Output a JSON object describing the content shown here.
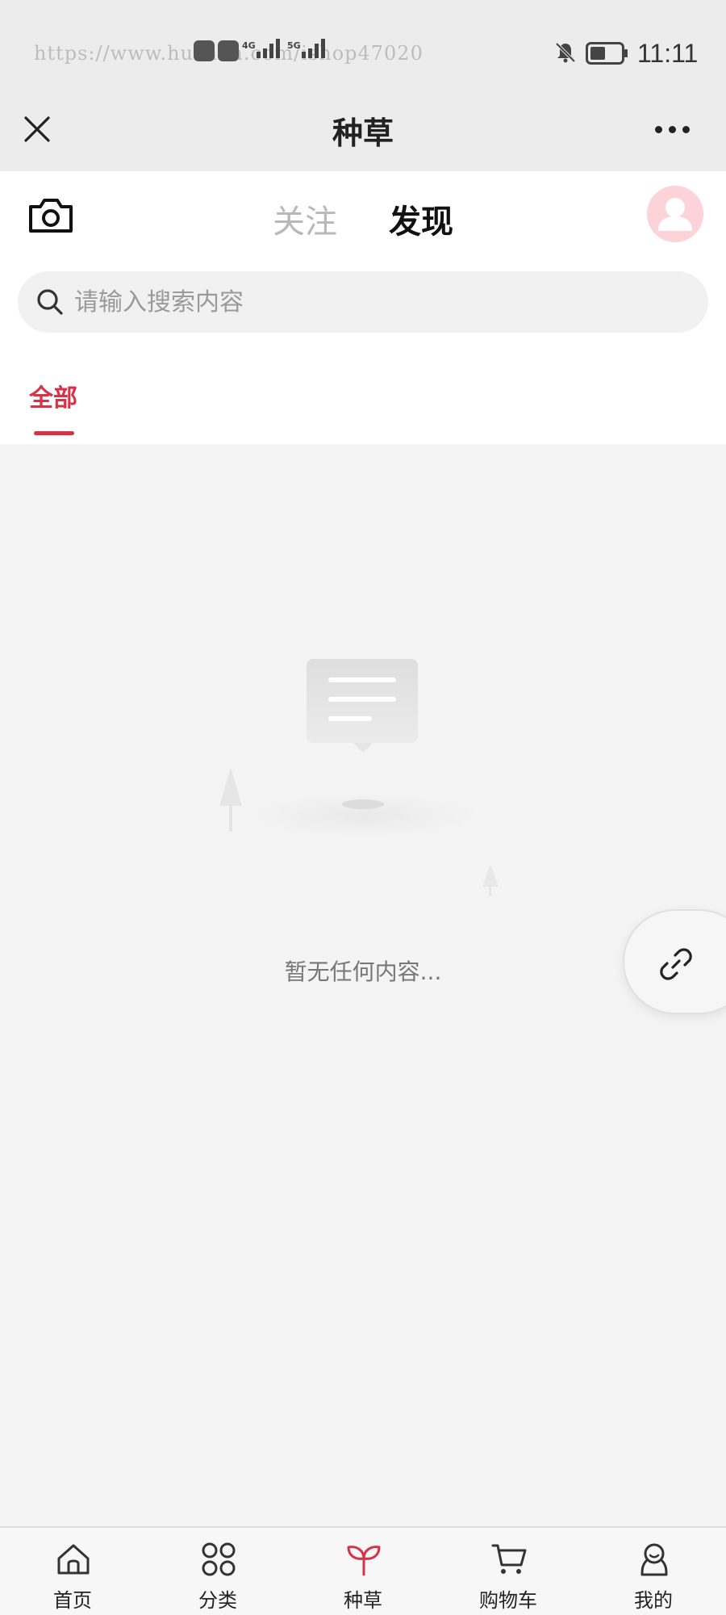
{
  "status_bar": {
    "watermark": "https://www.huzhan.com/ishop47020",
    "network_1": "4G",
    "network_2": "5G",
    "time": "11:11"
  },
  "title_bar": {
    "title": "种草",
    "close_icon": "close-icon",
    "more_icon": "more-icon"
  },
  "header": {
    "tabs": [
      {
        "label": "关注",
        "active": false
      },
      {
        "label": "发现",
        "active": true
      }
    ],
    "search": {
      "placeholder": "请输入搜索内容"
    },
    "category_tab": "全部"
  },
  "empty_state": {
    "message": "暂无任何内容..."
  },
  "bottom_nav": {
    "items": [
      {
        "label": "首页",
        "icon": "home-icon"
      },
      {
        "label": "分类",
        "icon": "grid-icon"
      },
      {
        "label": "种草",
        "icon": "sprout-icon",
        "active": true
      },
      {
        "label": "购物车",
        "icon": "cart-icon"
      },
      {
        "label": "我的",
        "icon": "profile-icon"
      }
    ]
  },
  "colors": {
    "accent": "#d63346",
    "background": "#f4f4f5",
    "title_bar": "#ececec"
  }
}
